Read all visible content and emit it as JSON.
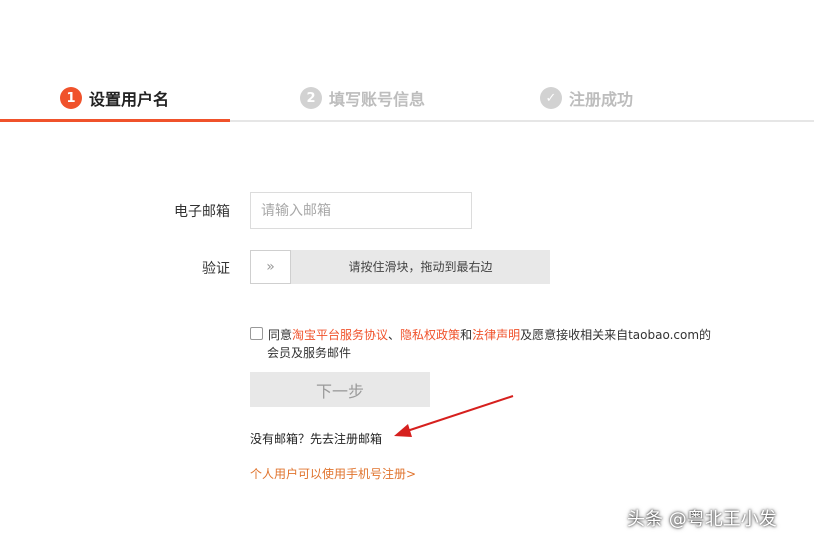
{
  "steps": [
    {
      "num": "1",
      "label": "设置用户名"
    },
    {
      "num": "2",
      "label": "填写账号信息"
    },
    {
      "num": "✓",
      "label": "注册成功"
    }
  ],
  "form": {
    "email_label": "电子邮箱",
    "email_placeholder": "请输入邮箱",
    "email_value": "",
    "verify_label": "验证",
    "slider_handle_icon": "double-chevron-right-icon",
    "slider_handle_glyph": "»",
    "slider_hint": "请按住滑块，拖动到最右边"
  },
  "agreement": {
    "prefix": "同意",
    "link1": "淘宝平台服务协议",
    "sep1": "、",
    "link2": "隐私权政策",
    "sep2": "和",
    "link3": "法律声明",
    "suffix": "及愿意接收相关来自taobao.com的",
    "line2": "会员及服务邮件",
    "checked": false
  },
  "next_button": "下一步",
  "no_email_text": "没有邮箱？先去注册邮箱",
  "mobile_link": "个人用户可以使用手机号注册>",
  "watermark": "头条 @粤北王小发",
  "colors": {
    "accent": "#f0522b",
    "link_orange": "#e0742e",
    "arrow_red": "#d6201e",
    "inactive": "#bdbdbd"
  }
}
